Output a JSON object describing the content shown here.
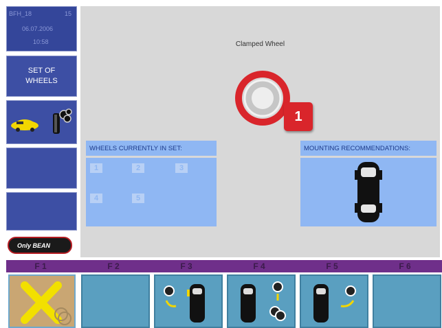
{
  "sidebar": {
    "info_id": "BFH_18",
    "info_num": "15",
    "info_date": "06.07.2006",
    "info_time": "10:58",
    "set_label": "SET OF WHEELS"
  },
  "main": {
    "clamped_title": "Clamped Wheel",
    "badge": "1",
    "wheels_header": "WHEELS CURRENTLY IN SET:",
    "slots": [
      "1",
      "2",
      "3",
      "4",
      "5"
    ],
    "mount_header": "MOUNTING RECOMMENDATIONS:"
  },
  "logo": {
    "text": "Only BEAN"
  },
  "fkeys": [
    "F 1",
    "F 2",
    "F 3",
    "F 4",
    "F 5",
    "F 6"
  ],
  "icons": {
    "f1": "cancel-x-icon",
    "f3": "rotate-wheel-icon",
    "f4": "wheel-set-icon",
    "f5": "swap-wheel-icon"
  },
  "colors": {
    "sidebar": "#3d4fa4",
    "panel_blue": "#8fb7f3",
    "badge_red": "#d9252b",
    "fbar_purple": "#6f2f8a",
    "fbtn_blue": "#5a9fc0"
  }
}
